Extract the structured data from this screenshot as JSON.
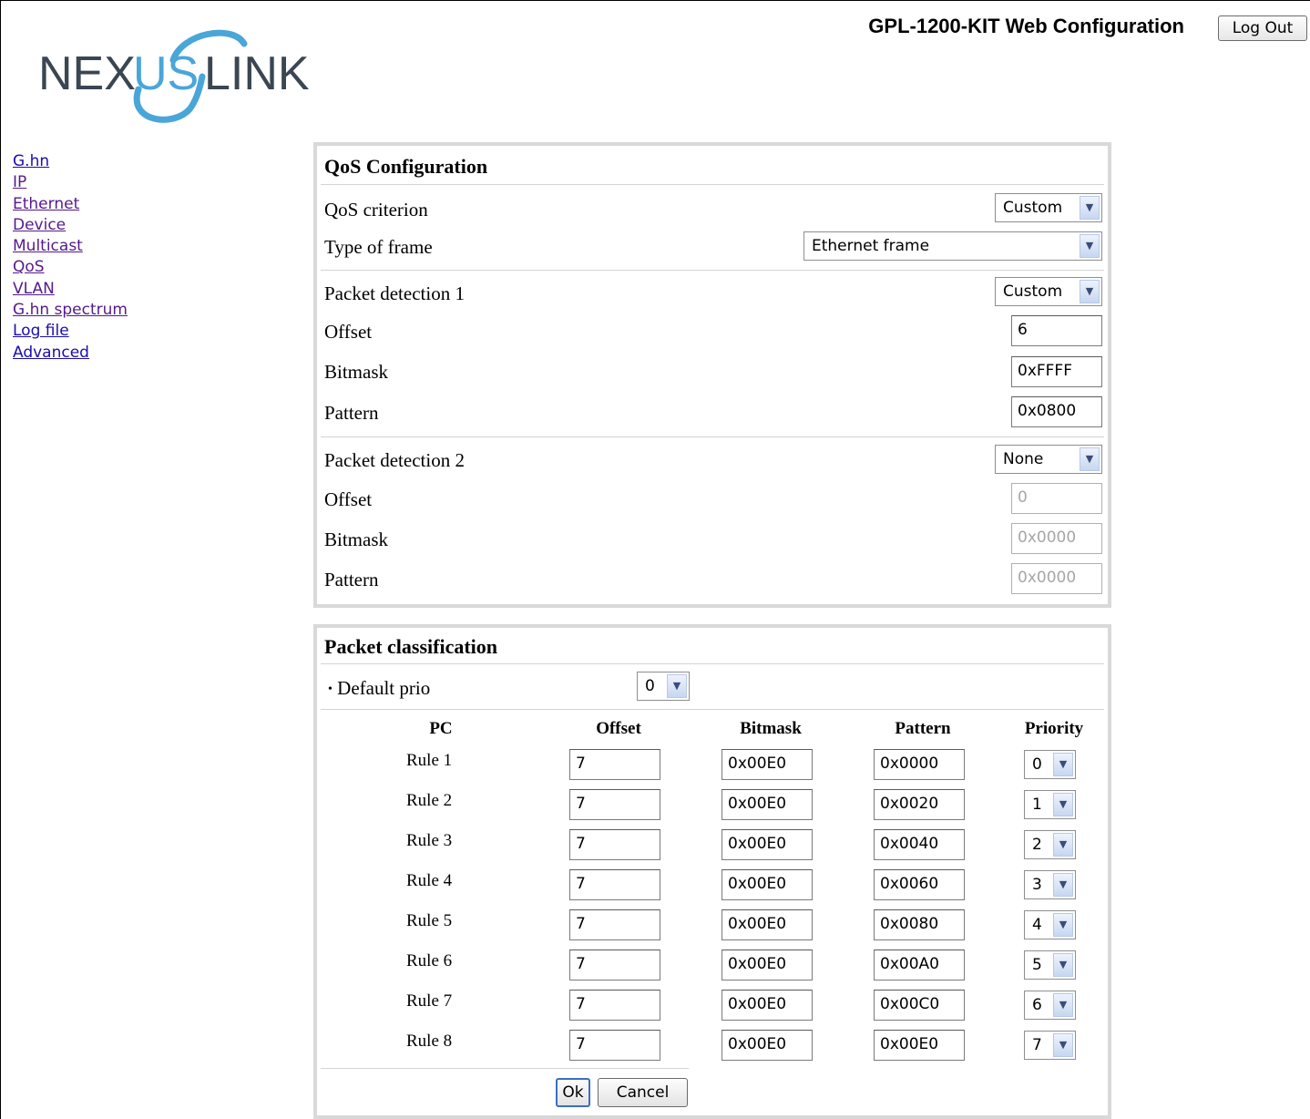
{
  "header": {
    "title": "GPL-1200-KIT Web Configuration",
    "logout_label": "Log Out"
  },
  "logo": {
    "text_nex": "NEX",
    "text_us": "US",
    "text_link": "LINK",
    "colors": {
      "dark": "#3a4652",
      "accent": "#4aa6d8"
    }
  },
  "sidebar": {
    "items": [
      {
        "label": "G.hn"
      },
      {
        "label": "IP"
      },
      {
        "label": "Ethernet"
      },
      {
        "label": "Device"
      },
      {
        "label": "Multicast"
      },
      {
        "label": "QoS"
      },
      {
        "label": "VLAN"
      },
      {
        "label": "G.hn spectrum"
      },
      {
        "label": "Log file"
      },
      {
        "label": "Advanced"
      }
    ]
  },
  "qos": {
    "title": "QoS Configuration",
    "criterion_label": "QoS criterion",
    "criterion_value": "Custom",
    "frame_label": "Type of frame",
    "frame_value": "Ethernet frame",
    "pd1": {
      "label": "Packet detection 1",
      "value": "Custom",
      "offset_label": "Offset",
      "offset": "6",
      "bitmask_label": "Bitmask",
      "bitmask": "0xFFFF",
      "pattern_label": "Pattern",
      "pattern": "0x0800"
    },
    "pd2": {
      "label": "Packet detection 2",
      "value": "None",
      "offset_label": "Offset",
      "offset": "0",
      "bitmask_label": "Bitmask",
      "bitmask": "0x0000",
      "pattern_label": "Pattern",
      "pattern": "0x0000"
    }
  },
  "pc": {
    "title": "Packet classification",
    "default_prio_label": "Default prio",
    "default_prio_value": "0",
    "columns": [
      "PC",
      "Offset",
      "Bitmask",
      "Pattern",
      "Priority"
    ],
    "rules": [
      {
        "label": "Rule 1",
        "offset": "7",
        "bitmask": "0x00E0",
        "pattern": "0x0000",
        "priority": "0"
      },
      {
        "label": "Rule 2",
        "offset": "7",
        "bitmask": "0x00E0",
        "pattern": "0x0020",
        "priority": "1"
      },
      {
        "label": "Rule 3",
        "offset": "7",
        "bitmask": "0x00E0",
        "pattern": "0x0040",
        "priority": "2"
      },
      {
        "label": "Rule 4",
        "offset": "7",
        "bitmask": "0x00E0",
        "pattern": "0x0060",
        "priority": "3"
      },
      {
        "label": "Rule 5",
        "offset": "7",
        "bitmask": "0x00E0",
        "pattern": "0x0080",
        "priority": "4"
      },
      {
        "label": "Rule 6",
        "offset": "7",
        "bitmask": "0x00E0",
        "pattern": "0x00A0",
        "priority": "5"
      },
      {
        "label": "Rule 7",
        "offset": "7",
        "bitmask": "0x00E0",
        "pattern": "0x00C0",
        "priority": "6"
      },
      {
        "label": "Rule 8",
        "offset": "7",
        "bitmask": "0x00E0",
        "pattern": "0x00E0",
        "priority": "7"
      }
    ],
    "ok_label": "Ok",
    "cancel_label": "Cancel"
  }
}
